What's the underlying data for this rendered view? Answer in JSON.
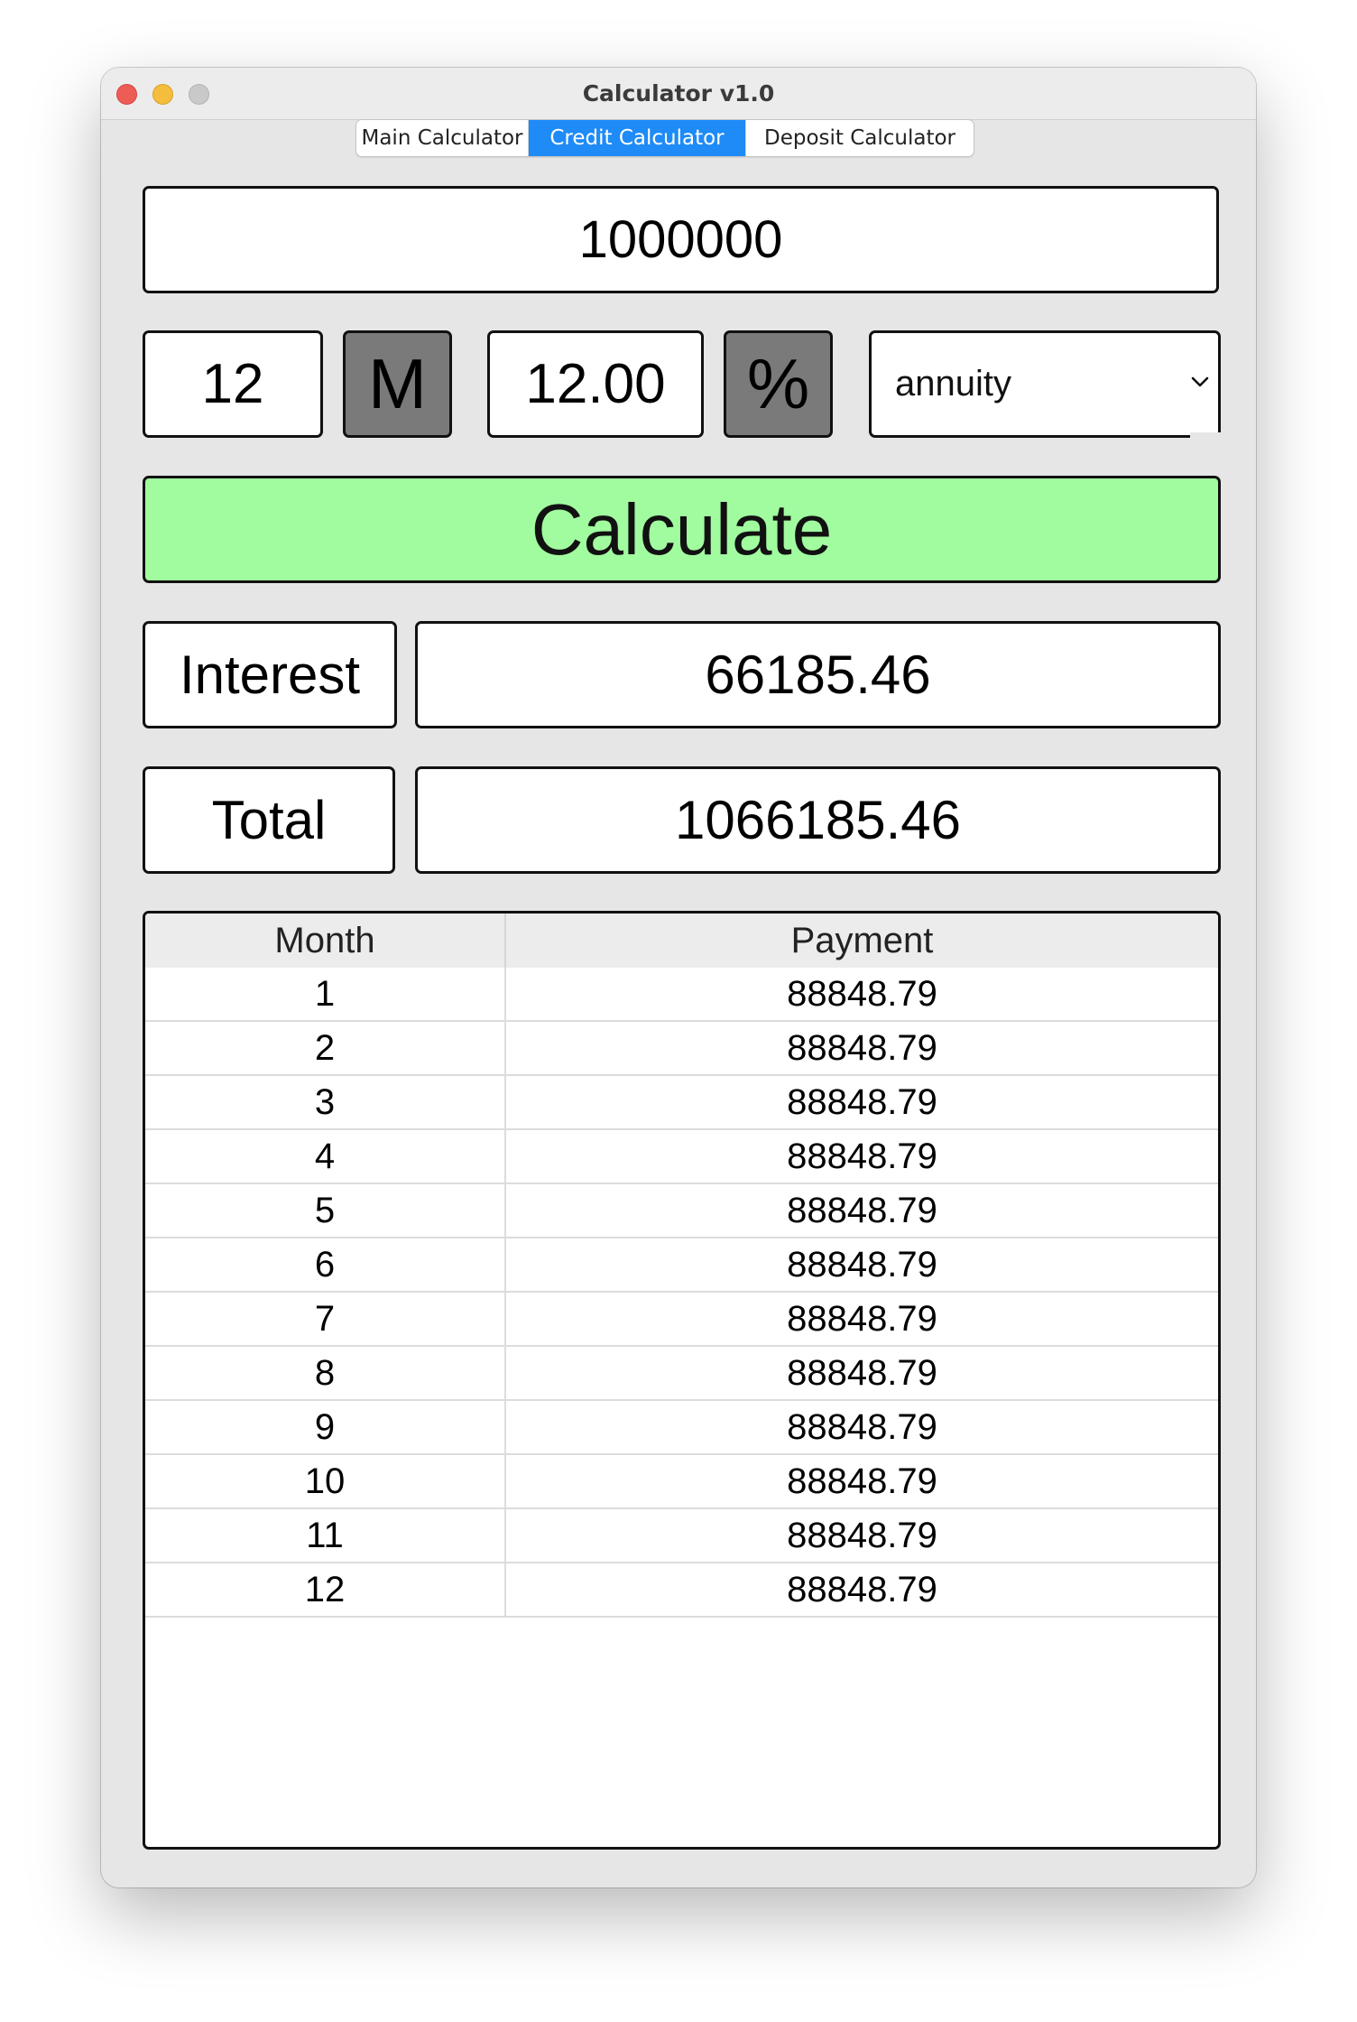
{
  "window": {
    "title": "Calculator v1.0"
  },
  "tabs": [
    {
      "label": "Main Calculator",
      "active": false
    },
    {
      "label": "Credit Calculator",
      "active": true
    },
    {
      "label": "Deposit Calculator",
      "active": false
    }
  ],
  "credit": {
    "amount": "1000000",
    "term_value": "12",
    "term_unit_button": "M",
    "rate_value": "12.00",
    "rate_unit_button": "%",
    "payment_type": "annuity",
    "calculate_label": "Calculate",
    "interest_label": "Interest",
    "interest_value": "66185.46",
    "total_label": "Total",
    "total_value": "1066185.46"
  },
  "schedule": {
    "headers": {
      "month": "Month",
      "payment": "Payment"
    },
    "rows": [
      {
        "month": "1",
        "payment": "88848.79"
      },
      {
        "month": "2",
        "payment": "88848.79"
      },
      {
        "month": "3",
        "payment": "88848.79"
      },
      {
        "month": "4",
        "payment": "88848.79"
      },
      {
        "month": "5",
        "payment": "88848.79"
      },
      {
        "month": "6",
        "payment": "88848.79"
      },
      {
        "month": "7",
        "payment": "88848.79"
      },
      {
        "month": "8",
        "payment": "88848.79"
      },
      {
        "month": "9",
        "payment": "88848.79"
      },
      {
        "month": "10",
        "payment": "88848.79"
      },
      {
        "month": "11",
        "payment": "88848.79"
      },
      {
        "month": "12",
        "payment": "88848.79"
      }
    ]
  },
  "colors": {
    "window_bg": "#e6e6e6",
    "active_tab": "#1e8bf7",
    "calculate_button": "#a1fb9f",
    "unit_button": "#7a7a7a",
    "close": "#ee5d55",
    "minimize": "#f5bd3d",
    "maximize": "#c9c9c9"
  },
  "icons": {
    "select_arrow": "chevron-down-icon"
  }
}
